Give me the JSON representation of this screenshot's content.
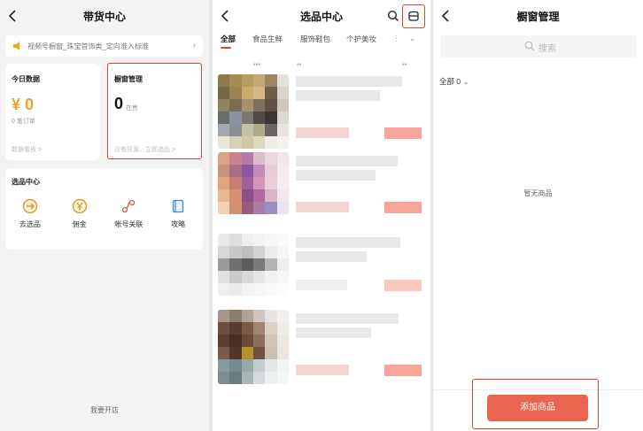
{
  "accent_color": "#e0422b",
  "panel1": {
    "title": "带货中心",
    "notice": "视频号橱窗_珠宝首饰类_定向准入标准",
    "today": {
      "title": "今日数据",
      "amount": "¥ 0",
      "orders": "0 笔订单",
      "link": "数据看板 >"
    },
    "showcase": {
      "title": "橱窗管理",
      "count": "0",
      "count_label": "在售",
      "link": "没有货源，立即选品 >"
    },
    "select_center": {
      "title": "选品中心",
      "items": [
        {
          "label": "去选品",
          "icon": "select-product-icon"
        },
        {
          "label": "佣金",
          "icon": "yen-icon"
        },
        {
          "label": "帐号关联",
          "icon": "link-icon"
        },
        {
          "label": "攻略",
          "icon": "book-icon"
        }
      ]
    },
    "bottom_link": "我要开店"
  },
  "panel2": {
    "title": "选品中心",
    "tabs": [
      "全部",
      "食品生鲜",
      "服饰鞋包",
      "个护美妆"
    ],
    "active_tab": 0
  },
  "panel3": {
    "title": "橱窗管理",
    "search_placeholder": "搜索",
    "filter_label": "全部 0",
    "empty_text": "暂无商品",
    "add_button": "添加商品"
  }
}
